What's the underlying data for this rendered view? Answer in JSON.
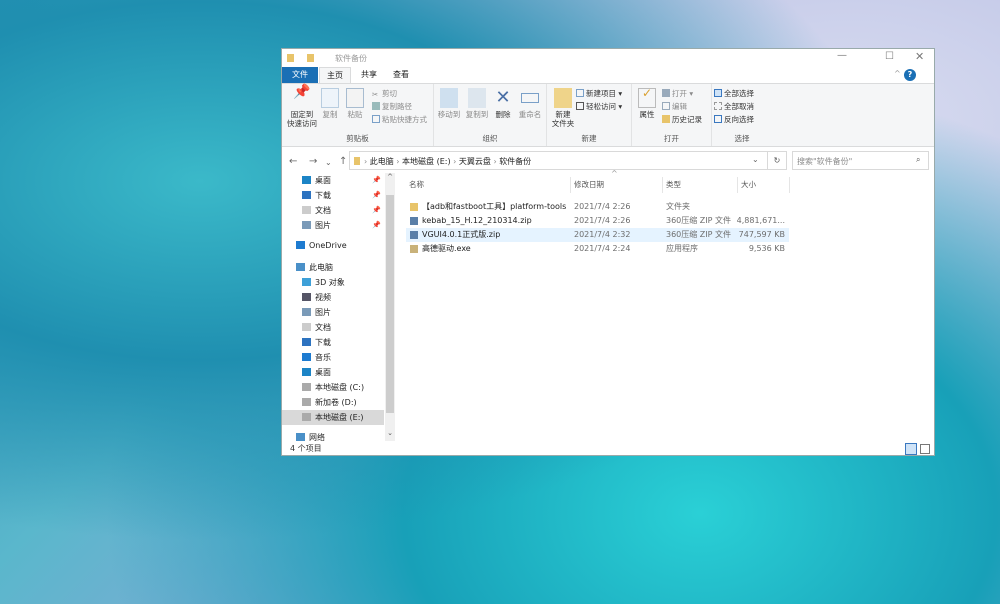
{
  "window": {
    "title": "软件备份",
    "minimize_icon": "minimize-icon",
    "maximize_icon": "maximize-icon",
    "close_icon": "close-icon"
  },
  "tabs": [
    {
      "label": "文件"
    },
    {
      "label": "主页"
    },
    {
      "label": "共享"
    },
    {
      "label": "查看"
    }
  ],
  "ribbon": {
    "clipboard": {
      "label": "剪贴板",
      "pin": "固定到\n快速访问",
      "copy": "复制",
      "paste": "粘贴",
      "cut": "剪切",
      "copy_path": "复制路径",
      "paste_shortcut": "粘贴快捷方式"
    },
    "organize": {
      "label": "组织",
      "move_to": "移动到",
      "copy_to": "复制到",
      "delete": "删除",
      "rename": "重命名"
    },
    "new": {
      "label": "新建",
      "new_folder": "新建\n文件夹",
      "new_item": "新建项目",
      "easy_access": "轻松访问"
    },
    "open": {
      "label": "打开",
      "properties": "属性",
      "open": "打开",
      "edit": "编辑",
      "history": "历史记录"
    },
    "select": {
      "label": "选择",
      "select_all": "全部选择",
      "select_none": "全部取消",
      "invert": "反向选择"
    }
  },
  "address": {
    "breadcrumb": [
      "此电脑",
      "本地磁盘 (E:)",
      "天翼云盘",
      "软件备份"
    ],
    "search_placeholder": "搜索\"软件备份\""
  },
  "sidebar": {
    "items": [
      {
        "label": "桌面",
        "icon": "desktop-icon",
        "pinned": true
      },
      {
        "label": "下载",
        "icon": "download-icon",
        "pinned": true
      },
      {
        "label": "文档",
        "icon": "document-icon",
        "pinned": true
      },
      {
        "label": "图片",
        "icon": "picture-icon",
        "pinned": true
      },
      {
        "label": "OneDrive",
        "icon": "cloud-icon"
      },
      {
        "label": "此电脑",
        "icon": "computer-icon"
      },
      {
        "label": "3D 对象",
        "icon": "cube-icon"
      },
      {
        "label": "视频",
        "icon": "video-icon"
      },
      {
        "label": "图片",
        "icon": "picture-icon"
      },
      {
        "label": "文档",
        "icon": "document-icon"
      },
      {
        "label": "下载",
        "icon": "download-icon"
      },
      {
        "label": "音乐",
        "icon": "music-icon"
      },
      {
        "label": "桌面",
        "icon": "desktop-icon"
      },
      {
        "label": "本地磁盘 (C:)",
        "icon": "drive-icon"
      },
      {
        "label": "新加卷 (D:)",
        "icon": "drive-icon"
      },
      {
        "label": "本地磁盘 (E:)",
        "icon": "drive-icon",
        "selected": true
      },
      {
        "label": "网络",
        "icon": "network-icon"
      }
    ]
  },
  "columns": {
    "name": "名称",
    "date": "修改日期",
    "type": "类型",
    "size": "大小"
  },
  "files": [
    {
      "name": "【adb和fastboot工具】platform-tools",
      "date": "2021/7/4 2:26",
      "type": "文件夹",
      "size": "",
      "icon": "folder-icon"
    },
    {
      "name": "kebab_15_H.12_210314.zip",
      "date": "2021/7/4 2:26",
      "type": "360压缩 ZIP 文件",
      "size": "4,881,671...",
      "icon": "zip-icon"
    },
    {
      "name": "VGUI4.0.1正式版.zip",
      "date": "2021/7/4 2:32",
      "type": "360压缩 ZIP 文件",
      "size": "747,597 KB",
      "icon": "zip-icon",
      "selected": true
    },
    {
      "name": "高德驱动.exe",
      "date": "2021/7/4 2:24",
      "type": "应用程序",
      "size": "9,536 KB",
      "icon": "exe-icon"
    }
  ],
  "status": {
    "count": "4 个项目"
  },
  "colors": {
    "accent": "#1a6fb5",
    "selection": "#e5f3ff"
  }
}
